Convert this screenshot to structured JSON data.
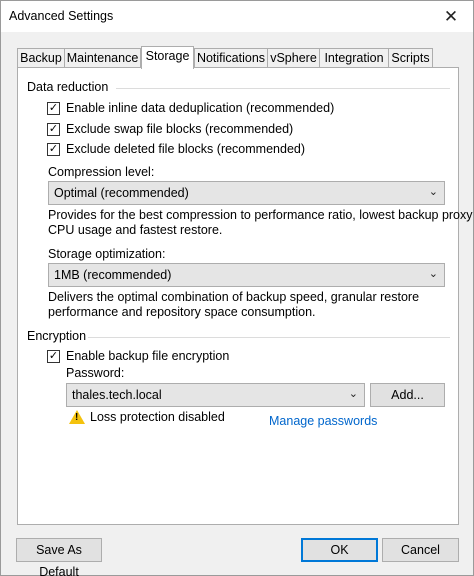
{
  "window": {
    "title": "Advanced Settings",
    "close_glyph": "✕"
  },
  "tabs": [
    {
      "label": "Backup"
    },
    {
      "label": "Maintenance"
    },
    {
      "label": "Storage"
    },
    {
      "label": "Notifications"
    },
    {
      "label": "vSphere"
    },
    {
      "label": "Integration"
    },
    {
      "label": "Scripts"
    }
  ],
  "active_tab": "Storage",
  "data_reduction": {
    "group_label": "Data reduction",
    "checkboxes": [
      {
        "label": "Enable inline data deduplication (recommended)",
        "checked": true
      },
      {
        "label": "Exclude swap file blocks (recommended)",
        "checked": true
      },
      {
        "label": "Exclude deleted file blocks (recommended)",
        "checked": true
      }
    ],
    "compression": {
      "label": "Compression level:",
      "value": "Optimal (recommended)",
      "description_line1": "Provides for the best compression to performance ratio, lowest backup proxy",
      "description_line2": "CPU usage and fastest restore."
    },
    "storage_optimization": {
      "label": "Storage optimization:",
      "value": "1MB (recommended)",
      "description_line1": "Delivers the optimal combination of backup speed, granular restore",
      "description_line2": "performance and repository space consumption."
    }
  },
  "encryption": {
    "group_label": "Encryption",
    "enable_label": "Enable backup file encryption",
    "enable_checked": true,
    "password_label": "Password:",
    "password_value": "thales.tech.local",
    "add_button": "Add...",
    "warning_text": "Loss protection disabled",
    "manage_link": "Manage passwords"
  },
  "footer": {
    "save_default": "Save As Default",
    "ok": "OK",
    "cancel": "Cancel"
  },
  "check_glyph": "✓",
  "dropdown_glyph": "⌄",
  "colors": {
    "link": "#0066cc",
    "warning": "#f4c20d",
    "primary_border": "#0078d7"
  }
}
